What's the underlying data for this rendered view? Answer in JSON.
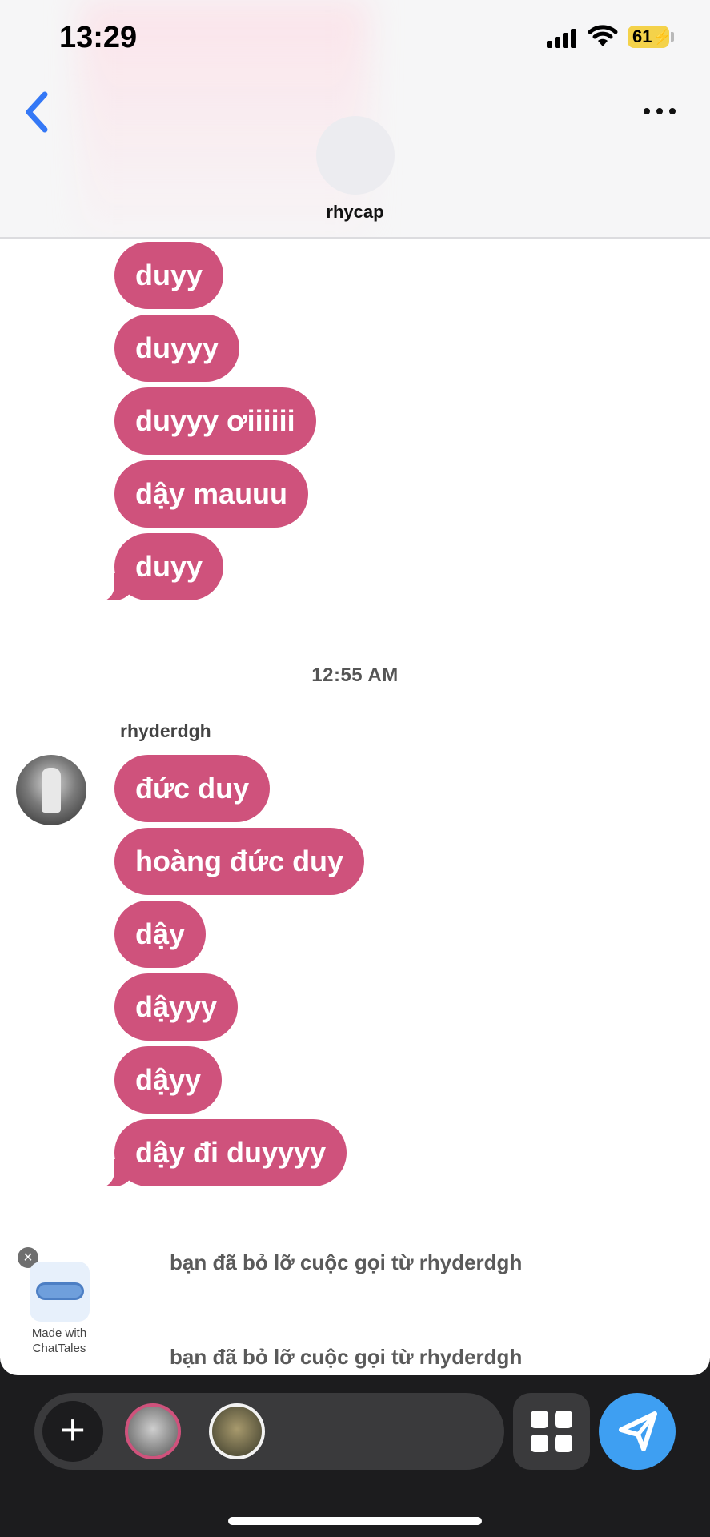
{
  "status_bar": {
    "time": "13:29",
    "battery": "61"
  },
  "header": {
    "title": "rhycap"
  },
  "messages_top": [
    "duyy",
    "duyyy",
    "duyyy ơiiiiii",
    "dậy mauuu",
    "duyy"
  ],
  "timestamp": "12:55 AM",
  "sender": {
    "name": "rhyderdgh"
  },
  "messages_bottom": [
    "đức duy",
    "hoàng đức duy",
    "dậy",
    "dậyyy",
    "dậyy",
    "dậy đi duyyyy"
  ],
  "missed_calls": [
    "bạn đã bỏ lỡ cuộc gọi từ rhyderdgh",
    "bạn đã bỏ lỡ cuộc gọi từ rhyderdgh"
  ],
  "promo": {
    "line1": "Made with",
    "line2": "ChatTales"
  },
  "colors": {
    "bubble": "#cf527c",
    "send": "#3e9ff2",
    "back": "#3478f6"
  }
}
